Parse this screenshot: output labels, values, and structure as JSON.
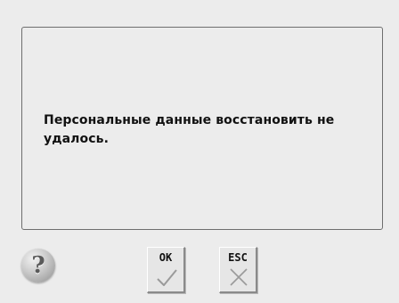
{
  "dialog": {
    "message": "Персональные данные восстановить не удалось."
  },
  "buttons": {
    "help_icon": "question-mark-icon",
    "help_glyph": "?",
    "ok_label": "OK",
    "ok_icon": "checkmark-icon",
    "esc_label": "ESC",
    "esc_icon": "cross-icon"
  },
  "colors": {
    "background": "#ececec",
    "border": "#6e6e6e",
    "icon": "#9a9a9a"
  }
}
